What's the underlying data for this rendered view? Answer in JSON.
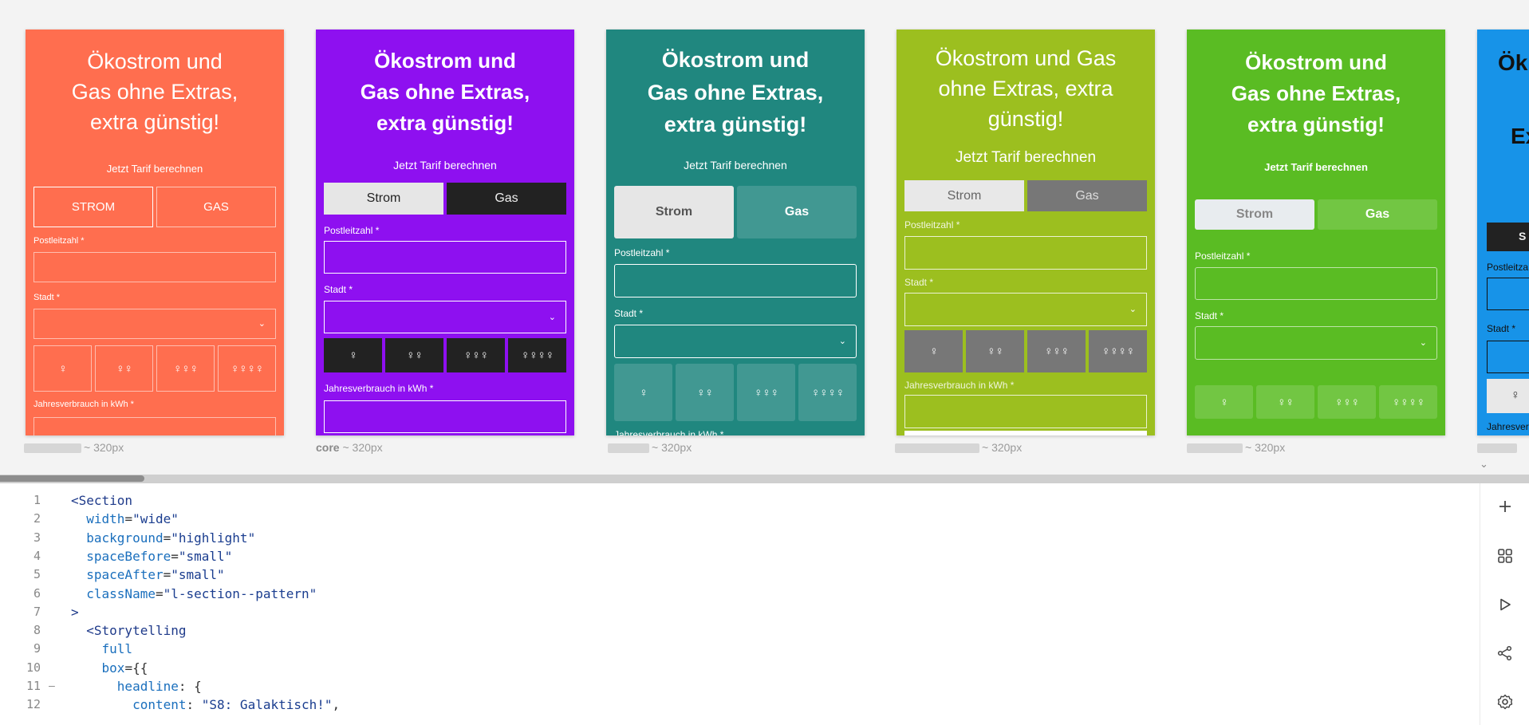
{
  "previews": [
    {
      "id": "p1",
      "label_blurred": true,
      "label_name": "",
      "label_size": "~ 320px",
      "bg": "#ff6e4f",
      "headline": [
        "Ökostrom und",
        "Gas ohne Extras,",
        "extra günstig!"
      ],
      "subline": "Jetzt Tarif berechnen",
      "tab_strom": "STROM",
      "tab_gas": "GAS",
      "plz_label": "Postleitzahl *",
      "stadt_label": "Stadt *",
      "verbrauch_label": "Jahresverbrauch in kWh *"
    },
    {
      "id": "p2",
      "label_blurred": false,
      "label_name": "core",
      "label_size": "~ 320px",
      "bg": "#8e10f0",
      "headline": [
        "Ökostrom und",
        "Gas ohne Extras,",
        "extra günstig!"
      ],
      "subline": "Jetzt Tarif berechnen",
      "tab_strom": "Strom",
      "tab_gas": "Gas",
      "plz_label": "Postleitzahl *",
      "stadt_label": "Stadt *",
      "verbrauch_label": "Jahresverbrauch in kWh *"
    },
    {
      "id": "p3",
      "label_blurred": true,
      "label_name": "",
      "label_size": "~ 320px",
      "bg": "#20877f",
      "headline": [
        "Ökostrom und",
        "Gas ohne Extras,",
        "extra günstig!"
      ],
      "subline": "Jetzt Tarif berechnen",
      "tab_strom": "Strom",
      "tab_gas": "Gas",
      "plz_label": "Postleitzahl *",
      "stadt_label": "Stadt *",
      "verbrauch_label": "Jahresverbrauch in kWh *"
    },
    {
      "id": "p4",
      "label_blurred": true,
      "label_name": "",
      "label_size": "~ 320px",
      "bg": "#9cbf1f",
      "headline": [
        "Ökostrom und Gas",
        "ohne Extras, extra",
        "günstig!"
      ],
      "subline": "Jetzt Tarif berechnen",
      "tab_strom": "Strom",
      "tab_gas": "Gas",
      "plz_label": "Postleitzahl *",
      "stadt_label": "Stadt *",
      "verbrauch_label": "Jahresverbrauch in kWh *"
    },
    {
      "id": "p5",
      "label_blurred": true,
      "label_name": "",
      "label_size": "~ 320px",
      "bg": "#5abc23",
      "headline": [
        "Ökostrom und",
        "Gas ohne Extras,",
        "extra günstig!"
      ],
      "subline": "Jetzt Tarif berechnen",
      "tab_strom": "Strom",
      "tab_gas": "Gas",
      "plz_label": "Postleitzahl *",
      "stadt_label": "Stadt *",
      "verbrauch_label": ""
    },
    {
      "id": "p6",
      "label_blurred": true,
      "label_name": "",
      "label_size": "",
      "bg": "#1793e8",
      "headline": [
        "Ök",
        "Ex"
      ],
      "subline": "",
      "tab_strom": "S",
      "tab_gas": "",
      "plz_label": "Postleitza",
      "stadt_label": "Stadt *",
      "verbrauch_label": "Jahresverbr"
    }
  ],
  "editor": {
    "lines": [
      {
        "n": "1",
        "fold": false,
        "parts": [
          [
            "tg",
            "<Section"
          ]
        ]
      },
      {
        "n": "2",
        "fold": false,
        "parts": [
          [
            "at",
            "  width"
          ],
          [
            "pn",
            "="
          ],
          [
            "st",
            "\"wide\""
          ]
        ]
      },
      {
        "n": "3",
        "fold": false,
        "parts": [
          [
            "at",
            "  background"
          ],
          [
            "pn",
            "="
          ],
          [
            "st",
            "\"highlight\""
          ]
        ]
      },
      {
        "n": "4",
        "fold": false,
        "parts": [
          [
            "at",
            "  spaceBefore"
          ],
          [
            "pn",
            "="
          ],
          [
            "st",
            "\"small\""
          ]
        ]
      },
      {
        "n": "5",
        "fold": false,
        "parts": [
          [
            "at",
            "  spaceAfter"
          ],
          [
            "pn",
            "="
          ],
          [
            "st",
            "\"small\""
          ]
        ]
      },
      {
        "n": "6",
        "fold": false,
        "parts": [
          [
            "at",
            "  className"
          ],
          [
            "pn",
            "="
          ],
          [
            "st",
            "\"l-section--pattern\""
          ]
        ]
      },
      {
        "n": "7",
        "fold": false,
        "parts": [
          [
            "tg",
            ">"
          ]
        ]
      },
      {
        "n": "8",
        "fold": false,
        "parts": [
          [
            "tg",
            "  <Storytelling"
          ]
        ]
      },
      {
        "n": "9",
        "fold": false,
        "parts": [
          [
            "at",
            "    full"
          ]
        ]
      },
      {
        "n": "10",
        "fold": false,
        "parts": [
          [
            "at",
            "    box"
          ],
          [
            "pn",
            "={{"
          ]
        ]
      },
      {
        "n": "11",
        "fold": true,
        "parts": [
          [
            "at",
            "      headline"
          ],
          [
            "pn",
            ": {"
          ]
        ]
      },
      {
        "n": "12",
        "fold": false,
        "parts": [
          [
            "at",
            "        content"
          ],
          [
            "pn",
            ": "
          ],
          [
            "st",
            "\"S8: Galaktisch!\""
          ],
          [
            "pn",
            ","
          ]
        ]
      }
    ]
  },
  "sidebar_icons": [
    "plus-icon",
    "grid-icon",
    "play-icon",
    "share-icon",
    "settings-icon"
  ]
}
